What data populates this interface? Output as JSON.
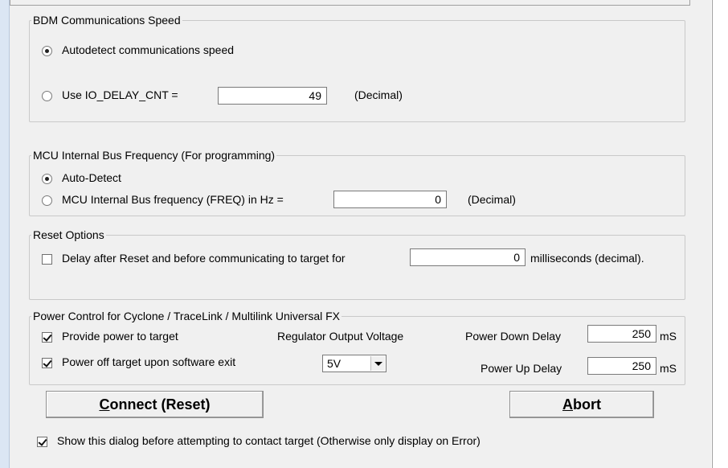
{
  "bdm": {
    "legend": "BDM Communications Speed",
    "auto_label": "Autodetect communications speed",
    "io_label": "Use IO_DELAY_CNT =",
    "io_value": "49",
    "io_unit": "(Decimal)"
  },
  "mcu": {
    "legend": "MCU Internal Bus Frequency (For programming)",
    "auto_label": "Auto-Detect",
    "freq_label": "MCU Internal Bus frequency (FREQ) in Hz =",
    "freq_value": "0",
    "freq_unit": "(Decimal)"
  },
  "reset": {
    "legend": "Reset Options",
    "delay_label": "Delay after Reset and before communicating to target for",
    "delay_value": "0",
    "delay_unit": "milliseconds (decimal)."
  },
  "power": {
    "legend": "Power Control for Cyclone / TraceLink / Multilink Universal FX",
    "provide_label": "Provide power to target",
    "off_label": "Power off target upon software exit",
    "regulator_label": "Regulator Output Voltage",
    "voltage_value": "5V",
    "down_label": "Power Down Delay",
    "down_value": "250",
    "down_unit": "mS",
    "up_label": "Power Up Delay",
    "up_value": "250",
    "up_unit": "mS"
  },
  "buttons": {
    "connect_first": "C",
    "connect_rest": "onnect (Reset)",
    "abort_first": "A",
    "abort_rest": "bort"
  },
  "footer": {
    "show_label": "Show this dialog before attempting to contact target (Otherwise only display on Error)"
  }
}
